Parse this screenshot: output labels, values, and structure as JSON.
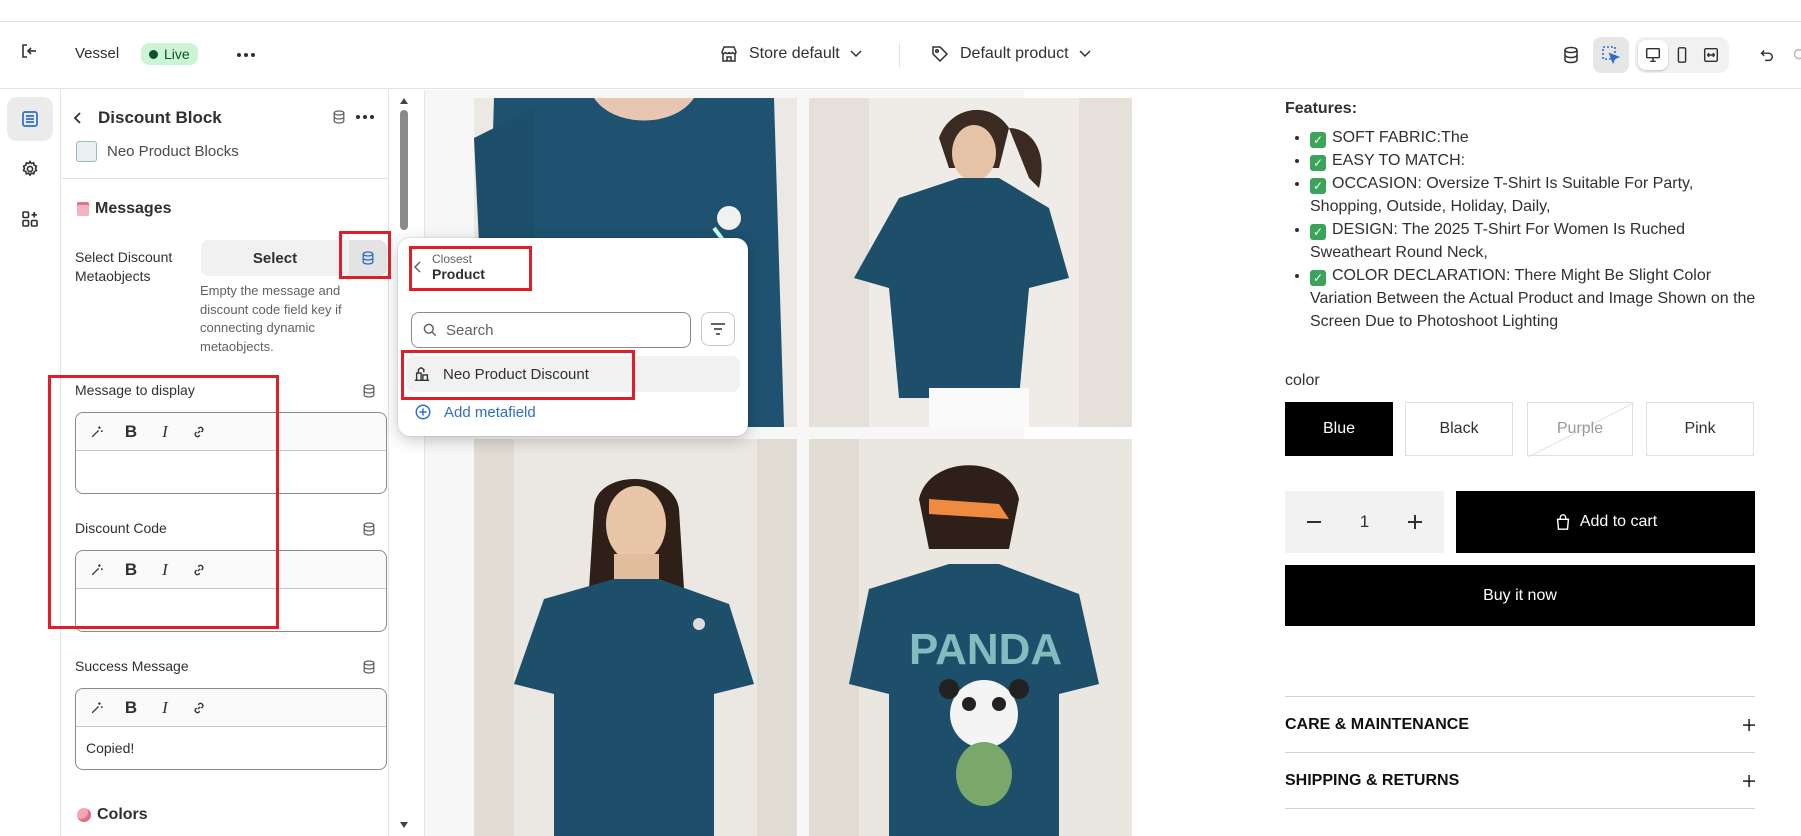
{
  "topbar": {
    "store_name": "Vessel",
    "status": "Live",
    "theme_select": "Store default",
    "template_select": "Default product"
  },
  "panel": {
    "title": "Discount Block",
    "app_name": "Neo Product Blocks",
    "section_messages": "Messages",
    "select_discount_label": "Select Discount Metaobjects",
    "select_button": "Select",
    "help_text": "Empty the message and discount code field key if connecting dynamic metaobjects.",
    "message_label": "Message to display",
    "message_value": "",
    "discount_label": "Discount Code",
    "discount_value": "",
    "success_label": "Success Message",
    "success_value": "Copied!",
    "section_colors": "Colors"
  },
  "popup": {
    "breadcrumb_top": "Closest",
    "breadcrumb_main": "Product",
    "search_placeholder": "Search",
    "item": "Neo Product Discount",
    "add_metafield": "Add metafield"
  },
  "product": {
    "features_title": "Features:",
    "features": [
      "SOFT FABRIC:The",
      "EASY TO MATCH:",
      "OCCASION: Oversize T-Shirt Is Suitable For Party, Shopping, Outside, Holiday, Daily,",
      "DESIGN: The 2025 T-Shirt For Women Is Ruched Sweatheart Round Neck,",
      "COLOR DECLARATION: There Might Be Slight Color Variation Between the Actual Product and Image Shown on the Screen Due to Photoshoot Lighting"
    ],
    "color_label": "color",
    "colors": [
      "Blue",
      "Black",
      "Purple",
      "Pink"
    ],
    "selected_color": "Blue",
    "quantity": "1",
    "add_to_cart": "Add to cart",
    "buy_now": "Buy it now",
    "accordion": [
      "CARE & MAINTENANCE",
      "SHIPPING & RETURNS"
    ],
    "brand_colors": {
      "tshirt": "#1d4f6b",
      "button": "#000000"
    }
  }
}
